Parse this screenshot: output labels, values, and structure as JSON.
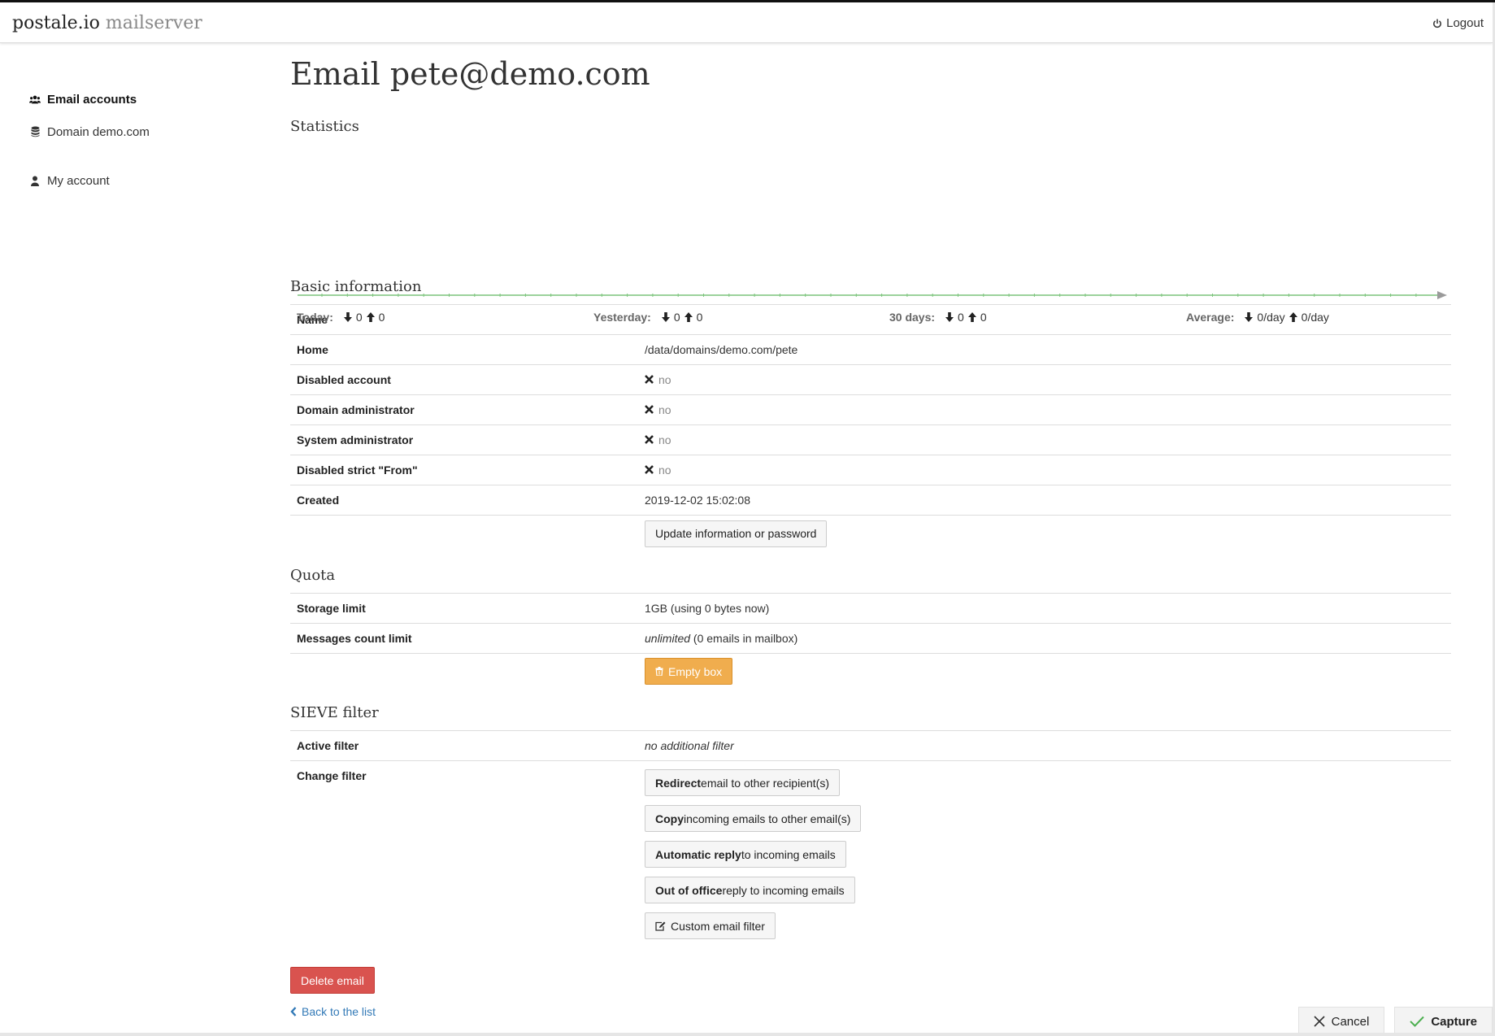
{
  "navbar": {
    "brand": "postale.io",
    "brand_sub": "mailserver",
    "logout_label": "Logout"
  },
  "sidebar": {
    "items": [
      {
        "label": "Email accounts",
        "icon": "users-icon"
      },
      {
        "label": "Domain demo.com",
        "icon": "database-icon"
      },
      {
        "label": "My account",
        "icon": "user-icon"
      }
    ]
  },
  "page": {
    "title": "Email pete@demo.com"
  },
  "statistics": {
    "heading": "Statistics",
    "today": {
      "label": "Today:",
      "in": "0",
      "out": "0"
    },
    "yesterday": {
      "label": "Yesterday:",
      "in": "0",
      "out": "0"
    },
    "days30": {
      "label": "30 days:",
      "in": "0",
      "out": "0"
    },
    "average": {
      "label": "Average:",
      "in": "0/day",
      "out": "0/day"
    }
  },
  "basic": {
    "heading": "Basic information",
    "rows": [
      {
        "key": "Name",
        "value": ""
      },
      {
        "key": "Home",
        "value": "/data/domains/demo.com/pete"
      },
      {
        "key": "Disabled account",
        "value": "no"
      },
      {
        "key": "Domain administrator",
        "value": "no"
      },
      {
        "key": "System administrator",
        "value": "no"
      },
      {
        "key": "Disabled strict \"From\"",
        "value": "no"
      },
      {
        "key": "Created",
        "value": "2019-12-02 15:02:08"
      }
    ],
    "update_button": "Update information or password"
  },
  "quota": {
    "heading": "Quota",
    "storage_key": "Storage limit",
    "storage_value": "1GB (using 0 bytes now)",
    "count_key": "Messages count limit",
    "count_value_em": "unlimited",
    "count_value_rest": " (0 emails in mailbox)",
    "empty_button": "Empty box"
  },
  "sieve": {
    "heading": "SIEVE filter",
    "active_key": "Active filter",
    "active_value": "no additional filter",
    "change_key": "Change filter",
    "buttons": [
      {
        "bold": "Redirect",
        "rest": " email to other recipient(s)"
      },
      {
        "bold": "Copy",
        "rest": " incoming emails to other email(s)"
      },
      {
        "bold": "Automatic reply",
        "rest": " to incoming emails"
      },
      {
        "bold": "Out of office",
        "rest": " reply to incoming emails"
      }
    ],
    "custom_button": "Custom email filter"
  },
  "actions": {
    "delete_button": "Delete email",
    "back_link": "Back to the list"
  },
  "capture_bar": {
    "cancel": "Cancel",
    "capture": "Capture"
  },
  "colors": {
    "chart_line": "#7cc47c",
    "warning": "#f0ad4e",
    "danger": "#d9534f",
    "link": "#337ab7"
  }
}
